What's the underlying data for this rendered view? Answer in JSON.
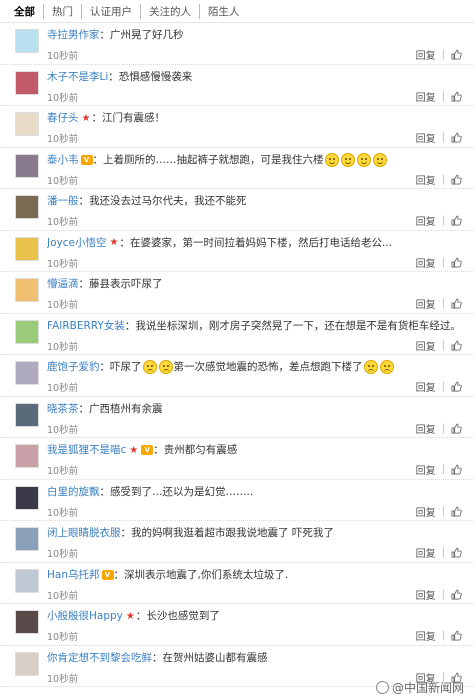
{
  "tabs": [
    "全部",
    "热门",
    "认证用户",
    "关注的人",
    "陌生人"
  ],
  "reply_label": "回复",
  "separator": "|",
  "comments": [
    {
      "user": "寺拉男作家",
      "badges": [],
      "text": "广州晃了好几秒",
      "emoji": [],
      "time": "10秒前",
      "avatar_color": "#b9e0f0"
    },
    {
      "user": "木子不是李Li",
      "badges": [],
      "text": "恐惧感慢慢袭来",
      "emoji": [],
      "time": "10秒前",
      "avatar_color": "#c25a6a"
    },
    {
      "user": "春仔头",
      "badges": [
        "star"
      ],
      "text": "江门有震感！",
      "emoji": [],
      "time": "10秒前",
      "avatar_color": "#e8dcc8"
    },
    {
      "user": "泰小韦",
      "badges": [
        "vip"
      ],
      "text": "上着厕所的……抽起裤子就想跑，可是我住六楼",
      "emoji": [
        "smile",
        "smile",
        "smile",
        "smile"
      ],
      "time": "10秒前",
      "avatar_color": "#8a7a8e"
    },
    {
      "user": "潘一般",
      "badges": [],
      "text": "我还没去过马尔代夫，我还不能死",
      "emoji": [],
      "time": "10秒前",
      "avatar_color": "#7a6a52"
    },
    {
      "user": "Joyce小悟空",
      "badges": [
        "star"
      ],
      "text": "在婆婆家，第一时间拉着妈妈下楼，然后打电话给老公...",
      "emoji": [],
      "time": "10秒前",
      "avatar_color": "#e8c24a"
    },
    {
      "user": "懵逼滴",
      "badges": [],
      "text": "藤县表示吓尿了",
      "emoji": [],
      "time": "10秒前",
      "avatar_color": "#f0c070"
    },
    {
      "user": "FAIRBERRY女装",
      "badges": [],
      "text": "我说坐标深圳，刚才房子突然晃了一下，还在想是不是有货柜车经过。",
      "emoji": [],
      "time": "10秒前",
      "avatar_color": "#9acb7a"
    },
    {
      "user": "鹿饱子爱豹",
      "badges": [],
      "text": "吓尿了",
      "emoji": [
        "cry",
        "cry"
      ],
      "text2": "第一次感觉地震的恐怖，差点想跑下楼了",
      "emoji2": [
        "cry",
        "cry"
      ],
      "time": "10秒前",
      "avatar_color": "#b0aac0"
    },
    {
      "user": "晓茶茶",
      "badges": [],
      "text": "广西梧州有余震",
      "emoji": [],
      "time": "10秒前",
      "avatar_color": "#5a6a7a"
    },
    {
      "user": "我是狐狸不是喵c",
      "badges": [
        "star",
        "vip"
      ],
      "text": "贵州都匀有震感",
      "emoji": [],
      "time": "10秒前",
      "avatar_color": "#caa0a8"
    },
    {
      "user": "白里的旋飘",
      "badges": [],
      "text": "感受到了…还以为是幻觉……..",
      "emoji": [],
      "time": "10秒前",
      "avatar_color": "#3a3a48"
    },
    {
      "user": "闭上眼睛脱衣服",
      "badges": [],
      "text": "我的妈啊我逛着超市跟我说地震了 吓死我了",
      "emoji": [],
      "time": "10秒前",
      "avatar_color": "#8aa0b8"
    },
    {
      "user": "Han乌托邦",
      "badges": [
        "vip"
      ],
      "text": "深圳表示地震了,你们系统太垃圾了.",
      "emoji": [],
      "time": "10秒前",
      "avatar_color": "#c0c8d4"
    },
    {
      "user": "小殷殷很Happy",
      "badges": [
        "star"
      ],
      "text": "长沙也感觉到了",
      "emoji": [],
      "time": "10秒前",
      "avatar_color": "#5a4a4a"
    },
    {
      "user": "你肯定想不到黎会吃鲜",
      "badges": [],
      "text": "在贺州姑婆山都有震感",
      "emoji": [],
      "time": "10秒前",
      "avatar_color": "#d8d0c8"
    }
  ],
  "watermark": "@中国新闻网"
}
